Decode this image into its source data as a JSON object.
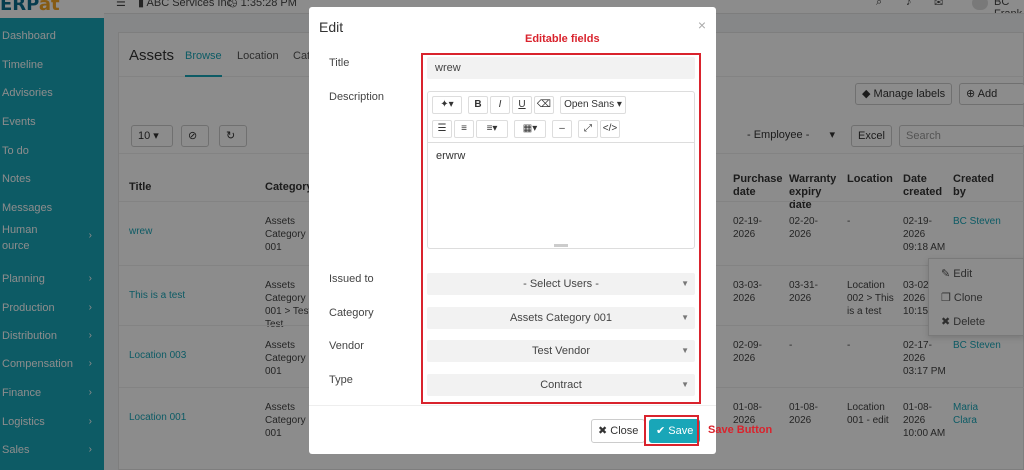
{
  "app": {
    "logo_prefix": "ERP",
    "logo_suffix": "at",
    "company": "ABC Services Inc.",
    "time": "1:35:28 PM",
    "user": "BC Frank"
  },
  "sidebar": {
    "items": [
      {
        "label": "Dashboard",
        "chevron": ""
      },
      {
        "label": "Timeline",
        "chevron": ""
      },
      {
        "label": "Advisories",
        "chevron": ""
      },
      {
        "label": "Events",
        "chevron": ""
      },
      {
        "label": "To do",
        "chevron": ""
      },
      {
        "label": "Notes",
        "chevron": ""
      },
      {
        "label": "Messages",
        "chevron": ""
      },
      {
        "label": "Human",
        "label2": "ource",
        "chevron": "›"
      },
      {
        "label": "Planning",
        "chevron": "›"
      },
      {
        "label": "Production",
        "chevron": "›"
      },
      {
        "label": "Distribution",
        "chevron": "›"
      },
      {
        "label": "Compensation",
        "chevron": "›"
      },
      {
        "label": "Finance",
        "chevron": "›"
      },
      {
        "label": "Logistics",
        "chevron": "›"
      },
      {
        "label": "Sales",
        "chevron": "›"
      }
    ]
  },
  "page": {
    "title": "Assets",
    "tabs": [
      "Browse",
      "Location",
      "Cat"
    ]
  },
  "toolbar": {
    "manage_labels": "Manage labels",
    "add_entry": "Add entry",
    "page_size": "10",
    "employee_filter": "- Employee -",
    "excel": "Excel",
    "search_placeholder": "Search"
  },
  "table": {
    "headers": [
      "Title",
      "Category",
      "Purchase date",
      "Warranty expiry date",
      "Location",
      "Date created",
      "Created by"
    ],
    "rows": [
      {
        "title": "wrew",
        "category": "Assets Category 001",
        "purchase": "02-19-2026",
        "warranty": "02-20-2026",
        "location": "-",
        "created": "02-19-2026 09:18 AM",
        "by": "BC Steven"
      },
      {
        "title": "This is a test",
        "category": "Assets Category 001 > Test Test",
        "purchase": "03-03-2026",
        "warranty": "03-31-2026",
        "location": "Location 002 > This is a test",
        "created": "03-02-2026 10:15 AM",
        "by": ""
      },
      {
        "title": "Location 003",
        "category": "Assets Category 001",
        "purchase": "02-09-2026",
        "warranty": "-",
        "location": "-",
        "created": "02-17-2026 03:17 PM",
        "by": "BC Steven"
      },
      {
        "title": "Location 001",
        "category": "Assets Category 001",
        "purchase": "01-08-2026",
        "warranty": "01-08-2026",
        "location": "Location 001 - edit",
        "created": "01-08-2026 10:00 AM",
        "by": "Maria Clara"
      }
    ]
  },
  "context_menu": {
    "edit": "Edit",
    "clone": "Clone",
    "delete": "Delete"
  },
  "modal": {
    "title": "Edit",
    "labels": {
      "title": "Title",
      "description": "Description",
      "issued_to": "Issued to",
      "category": "Category",
      "vendor": "Vendor",
      "type": "Type"
    },
    "values": {
      "title": "wrew",
      "description": "erwrw",
      "issued_to": "- Select Users -",
      "category": "Assets Category 001",
      "vendor": "Test Vendor",
      "type": "Contract"
    },
    "editor_font": "Open Sans",
    "close": "Close",
    "save": "Save"
  },
  "annotations": {
    "editable": "Editable fields",
    "save_button": "Save Button",
    "color": "#d9232d"
  }
}
